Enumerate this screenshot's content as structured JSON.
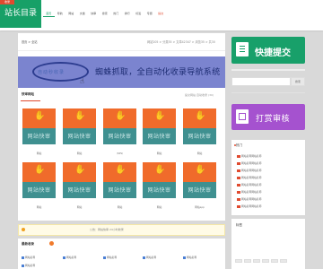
{
  "header": {
    "logo_text": "站长目录",
    "logo_ribbon": "收录",
    "nav": [
      "首页",
      "导航",
      "网站",
      "文章",
      "快审",
      "搜索",
      "热门",
      "排行",
      "标签",
      "专题",
      "提交"
    ]
  },
  "main": {
    "breadcrumb": "首页 > 全站",
    "stats": "网站205 > 分类35 > 文章42347 > 浏览35 > 共30",
    "banner": {
      "oval_text": "自动秒收录",
      "slogan": "蜘蛛抓取，全自动化收录导航系统"
    },
    "section_title": "快审网站",
    "section_right": "提交网站 自动收录 (30)",
    "cards": [
      {
        "label": "网站快审",
        "caption": "网站"
      },
      {
        "label": "网站快审",
        "caption": "网站"
      },
      {
        "label": "网站快审",
        "caption": "(SPS)"
      },
      {
        "label": "网站快审",
        "caption": "网站"
      },
      {
        "label": "网站快审",
        "caption": "网站"
      },
      {
        "label": "网站快审",
        "caption": "网站"
      },
      {
        "label": "网站快审",
        "caption": "网站"
      },
      {
        "label": "网站快审",
        "caption": "网站"
      },
      {
        "label": "网站快审",
        "caption": "网站"
      },
      {
        "label": "网站快审",
        "caption": "网站app"
      }
    ],
    "notice": {
      "text": "公告：网站快审 24小时收录"
    },
    "bottom": {
      "title": "最新收录",
      "rows": [
        "网站名称",
        "网站名称",
        "网站名称",
        "网站名称",
        "网站名称",
        "网站名称"
      ]
    }
  },
  "sidebar": {
    "submit_label": "快捷提交",
    "search_button": "搜索",
    "search_placeholder": "",
    "review_label": "打赏审核",
    "panel_title": "热门",
    "panel_rows": [
      "网站名称网站名称",
      "网站名称网站名称",
      "网站名称网站名称",
      "网站名称网站名称",
      "网站名称网站名称",
      "网站名称网站名称",
      "网站名称网站名称",
      "网站名称网站名称"
    ],
    "panel2_title": "标签"
  },
  "colors": {
    "brand_green": "#17a067",
    "card_orange": "#f06b2b",
    "card_teal": "#3f9090",
    "banner": "#7b84cf",
    "review_purple": "#a552cf"
  },
  "icons": [
    "hand-icon",
    "cursor-icon",
    "submit-icon",
    "review-icon",
    "notice-icon"
  ]
}
